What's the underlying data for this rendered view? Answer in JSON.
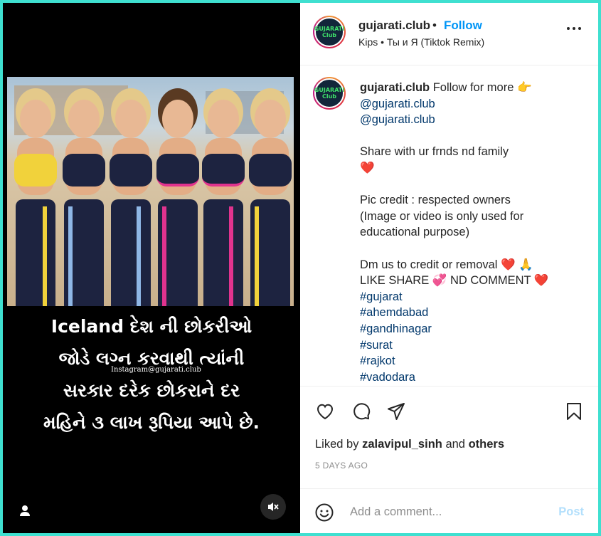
{
  "post": {
    "username": "gujarati.club",
    "follow_label": "Follow",
    "separator": "•",
    "audio": "Kips • Ты и Я (Tiktok Remix)",
    "avatar_text": "GUJARATI Club"
  },
  "media": {
    "caption_lines": [
      "Iceland દેશ ની છોકરીઓ",
      "જોડે લગ્ન કરવાથી ત્યાંની",
      "સરકાર દરેક છોકરાને દર",
      "મહિને ૩ લાખ રૂપિયા આપે છે."
    ],
    "watermark": "Instagram@gujarati.club",
    "icons": {
      "user_tag": "person-icon",
      "mute": "speaker-muted-icon"
    }
  },
  "caption": {
    "username": "gujarati.club",
    "intro": "Follow for more",
    "intro_emoji": "👉",
    "mentions": [
      "@gujarati.club",
      "@gujarati.club"
    ],
    "share_line": "Share with ur frnds nd family",
    "heart_emoji": "❤️",
    "credit_line1": "Pic credit : respected owners",
    "credit_line2": "(Image or video is only used for",
    "credit_line3": "educational purpose)",
    "dm_line": "Dm us to credit or removal",
    "dm_emoji": "❤️ 🙏",
    "like_share": "LIKE SHARE",
    "like_share_emoji": "💞",
    "nd_comment": "ND COMMENT",
    "nd_comment_emoji": "❤️",
    "hashtags": [
      "#gujarat",
      "#ahemdabad",
      "#gandhinagar",
      "#surat",
      "#rajkot",
      "#vadodara"
    ]
  },
  "actions": {
    "icons": [
      "heart-icon",
      "comment-icon",
      "share-icon",
      "bookmark-icon"
    ]
  },
  "likes": {
    "prefix": "Liked by",
    "user": "zalavipul_sinh",
    "and": "and",
    "others": "others"
  },
  "timestamp": "5 DAYS AGO",
  "add_comment": {
    "placeholder": "Add a comment...",
    "post_label": "Post"
  },
  "colors": {
    "follow": "#0095f6",
    "link": "#00376b",
    "post_disabled": "#b2dffc",
    "border": "#3fe0d0"
  }
}
